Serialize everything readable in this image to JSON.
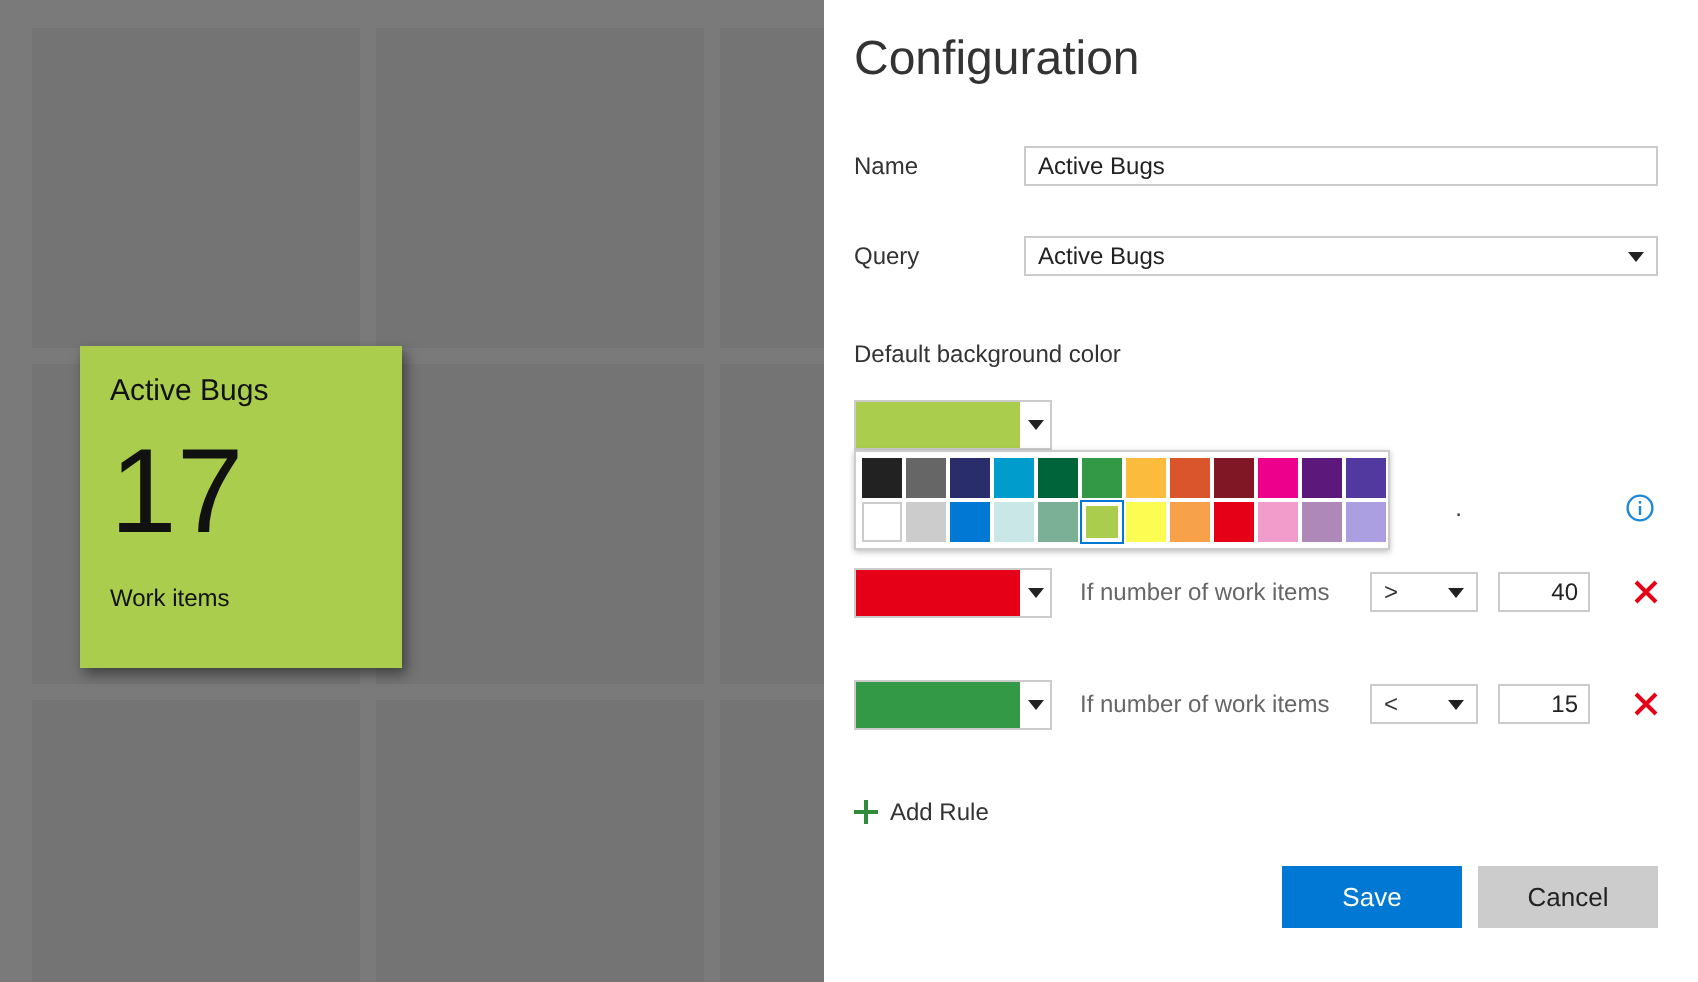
{
  "tile": {
    "title": "Active Bugs",
    "count": "17",
    "caption": "Work items",
    "color": "#aacd4e"
  },
  "panel": {
    "title": "Configuration",
    "name_field": {
      "label": "Name",
      "value": "Active Bugs"
    },
    "query_field": {
      "label": "Query",
      "value": "Active Bugs"
    },
    "default_color": {
      "label": "Default background color",
      "color": "#aacd4e",
      "palette": [
        {
          "color": "#222222",
          "selected": false
        },
        {
          "color": "#666666",
          "selected": false
        },
        {
          "color": "#292e6b",
          "selected": false
        },
        {
          "color": "#009ccc",
          "selected": false
        },
        {
          "color": "#00643a",
          "selected": false
        },
        {
          "color": "#339947",
          "selected": false
        },
        {
          "color": "#fbbc3d",
          "selected": false
        },
        {
          "color": "#db552c",
          "selected": false
        },
        {
          "color": "#7f1725",
          "selected": false
        },
        {
          "color": "#ec008c",
          "selected": false
        },
        {
          "color": "#5c197b",
          "selected": false
        },
        {
          "color": "#51399f",
          "selected": false
        },
        {
          "color": "#ffffff",
          "selected": false
        },
        {
          "color": "#cccccc",
          "selected": false
        },
        {
          "color": "#0078d4",
          "selected": false
        },
        {
          "color": "#c9e7e7",
          "selected": false
        },
        {
          "color": "#7bb097",
          "selected": false
        },
        {
          "color": "#aacd4e",
          "selected": true
        },
        {
          "color": "#fbfd52",
          "selected": false
        },
        {
          "color": "#f7a24b",
          "selected": false
        },
        {
          "color": "#e60017",
          "selected": false
        },
        {
          "color": "#f29ccc",
          "selected": false
        },
        {
          "color": "#ae88b9",
          "selected": false
        },
        {
          "color": "#ac9fe1",
          "selected": false
        }
      ]
    },
    "hidden_row_text": ".",
    "rules": [
      {
        "color": "#e60017",
        "label": "If number of work items",
        "operator": ">",
        "value": "40"
      },
      {
        "color": "#339947",
        "label": "If number of work items",
        "operator": "<",
        "value": "15"
      }
    ],
    "add_rule": "Add Rule",
    "buttons": [
      {
        "label": "Save",
        "kind": "primary"
      },
      {
        "label": "Cancel",
        "kind": "secondary"
      }
    ]
  }
}
